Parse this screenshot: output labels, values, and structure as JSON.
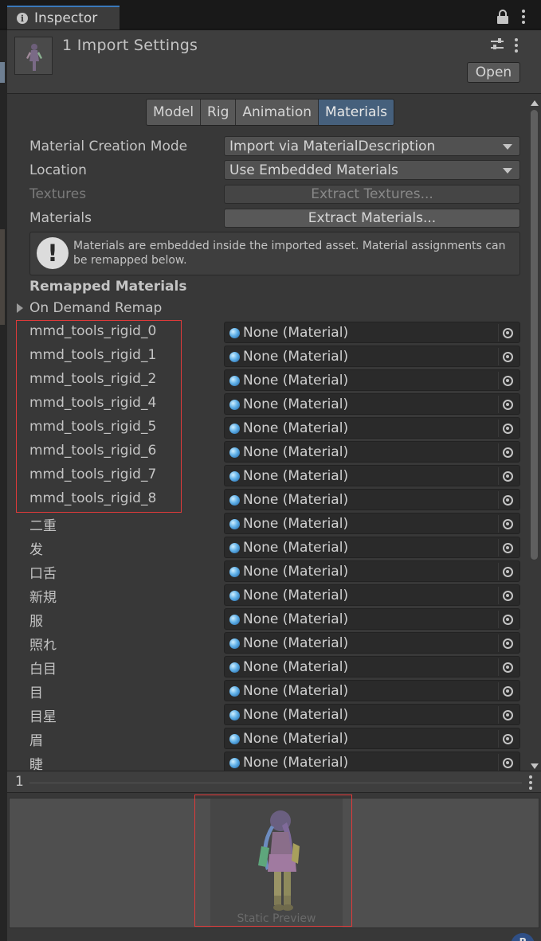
{
  "tab": {
    "title": "Inspector",
    "info_icon": "i"
  },
  "header": {
    "title": "1 Import Settings",
    "open_label": "Open"
  },
  "tabs": [
    "Model",
    "Rig",
    "Animation",
    "Materials"
  ],
  "active_tab": "Materials",
  "properties": {
    "material_creation_mode": {
      "label": "Material Creation Mode",
      "value": "Import via MaterialDescription"
    },
    "location": {
      "label": "Location",
      "value": "Use Embedded Materials"
    },
    "textures": {
      "label": "Textures",
      "button": "Extract Textures..."
    },
    "materials": {
      "label": "Materials",
      "button": "Extract Materials..."
    }
  },
  "help": {
    "icon": "!",
    "text": "Materials are embedded inside the imported asset. Material assignments can be remapped below."
  },
  "remapped": {
    "title": "Remapped Materials",
    "on_demand": "On Demand Remap",
    "none_value": "None (Material)",
    "items": [
      "mmd_tools_rigid_0",
      "mmd_tools_rigid_1",
      "mmd_tools_rigid_2",
      "mmd_tools_rigid_4",
      "mmd_tools_rigid_5",
      "mmd_tools_rigid_6",
      "mmd_tools_rigid_7",
      "mmd_tools_rigid_8",
      "二重",
      "发",
      "口舌",
      "新規",
      "服",
      "照れ",
      "白目",
      "目",
      "目星",
      "眉",
      "睫"
    ]
  },
  "footer": {
    "count": "1",
    "preview_caption": "Static Preview"
  },
  "colors": {
    "accent_tab": "#3a79bb",
    "active_segment": "#46607c",
    "highlight": "#e03a3a",
    "material_icon": "#5fb0e8"
  }
}
